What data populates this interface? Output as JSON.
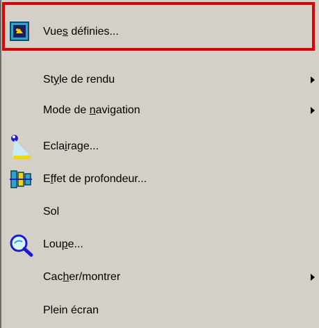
{
  "menu": {
    "items": [
      {
        "label_before": "Vue",
        "mnemonic": "s",
        "label_after": " définies...",
        "has_submenu": false,
        "icon": "views-icon"
      },
      {
        "label_before": "St",
        "mnemonic": "y",
        "label_after": "le de rendu",
        "has_submenu": true,
        "icon": ""
      },
      {
        "label_before": "Mode de ",
        "mnemonic": "n",
        "label_after": "avigation",
        "has_submenu": true,
        "icon": ""
      },
      {
        "label_before": "Ecla",
        "mnemonic": "i",
        "label_after": "rage...",
        "has_submenu": false,
        "icon": "lighting-icon"
      },
      {
        "label_before": "E",
        "mnemonic": "f",
        "label_after": "fet de profondeur...",
        "has_submenu": false,
        "icon": "depth-effect-icon"
      },
      {
        "label_before": "Sol",
        "mnemonic": "",
        "label_after": "",
        "has_submenu": false,
        "icon": ""
      },
      {
        "label_before": "Lou",
        "mnemonic": "p",
        "label_after": "e...",
        "has_submenu": false,
        "icon": "magnifier-icon"
      },
      {
        "label_before": "Cac",
        "mnemonic": "h",
        "label_after": "er/montrer",
        "has_submenu": true,
        "icon": ""
      },
      {
        "label_before": "Plein écran",
        "mnemonic": "",
        "label_after": "",
        "has_submenu": false,
        "icon": ""
      }
    ]
  },
  "colors": {
    "menu_bg": "#d4d0c8",
    "highlight_border": "#e00000"
  }
}
